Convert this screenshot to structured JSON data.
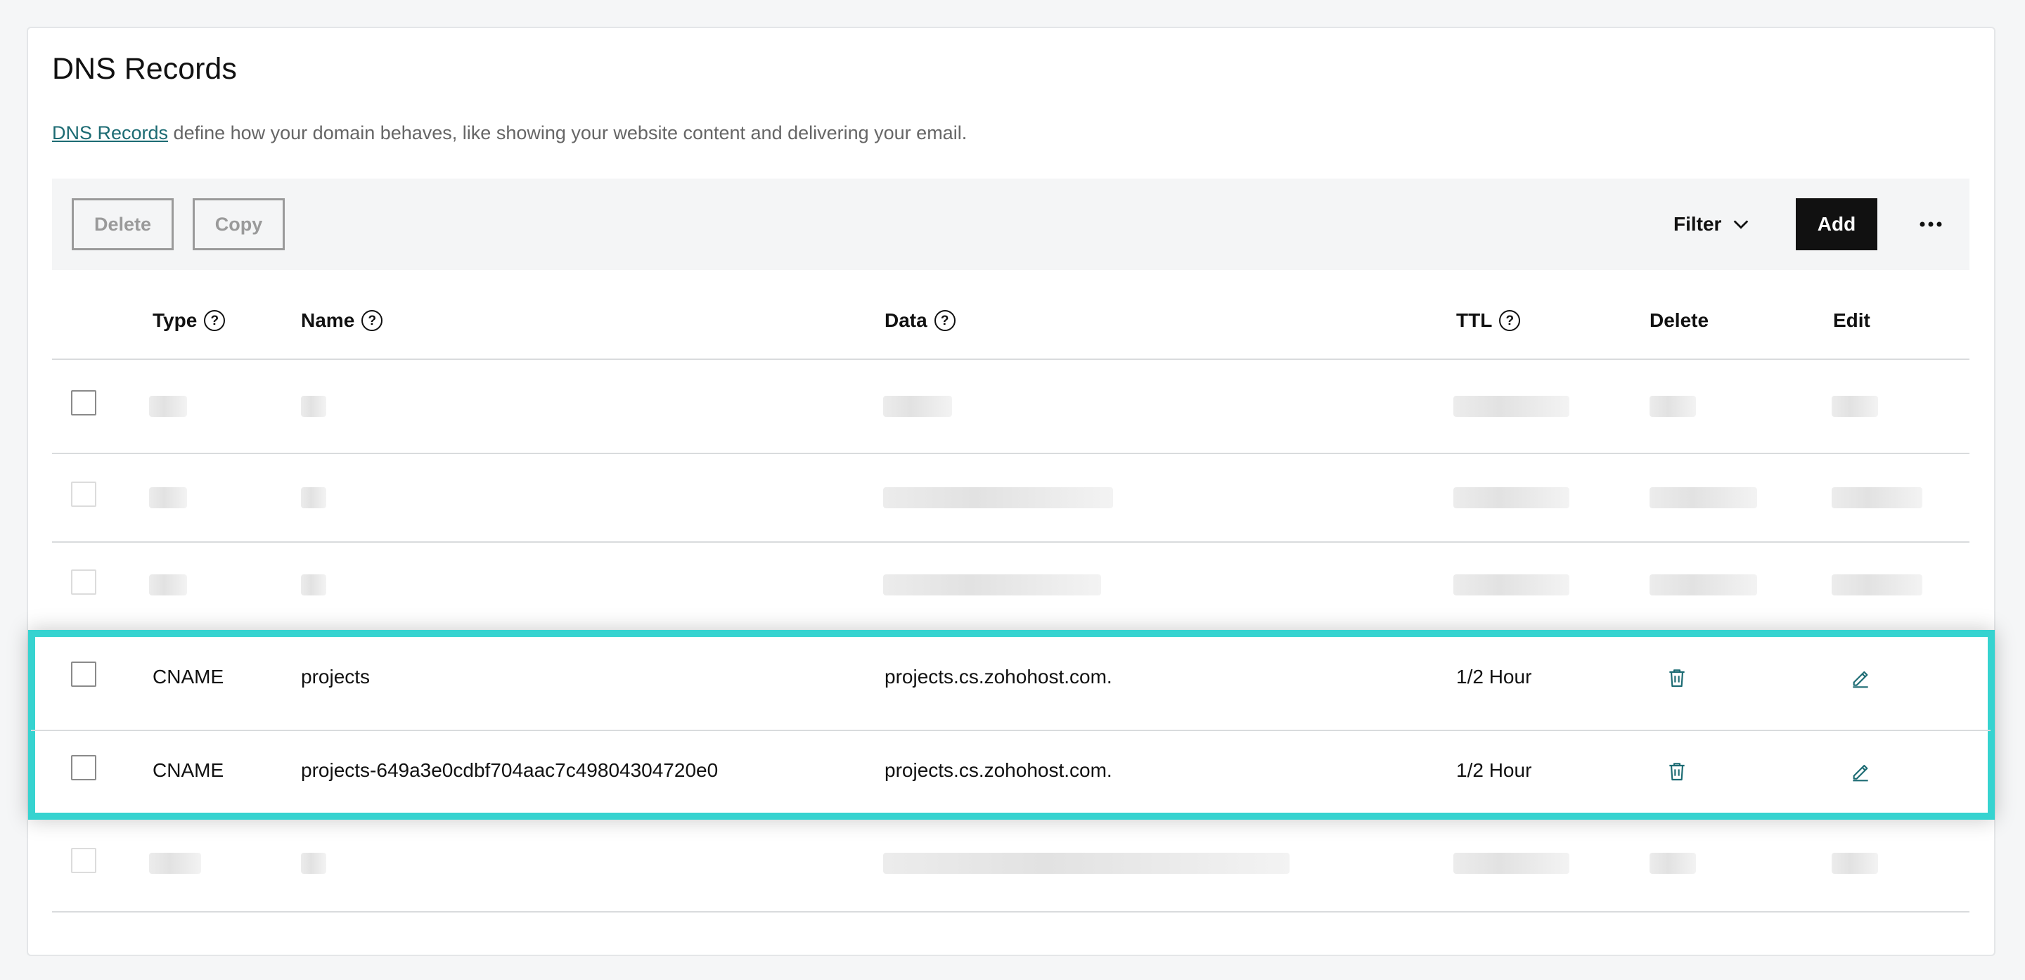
{
  "page": {
    "title": "DNS Records",
    "description_link": "DNS Records",
    "description_rest": " define how your domain behaves, like showing your website content and delivering your email."
  },
  "toolbar": {
    "delete_label": "Delete",
    "copy_label": "Copy",
    "filter_label": "Filter",
    "add_label": "Add"
  },
  "table": {
    "columns": [
      "Type",
      "Name",
      "Data",
      "TTL",
      "Delete",
      "Edit"
    ],
    "help_glyph": "?",
    "rows": [
      {
        "type": "CNAME",
        "name": "projects",
        "data": "projects.cs.zohohost.com.",
        "ttl": "1/2 Hour"
      },
      {
        "type": "CNAME",
        "name": "projects-649a3e0cdbf704aac7c49804304720e0",
        "data": "projects.cs.zohohost.com.",
        "ttl": "1/2 Hour"
      }
    ]
  },
  "colors": {
    "accent_teal": "#1c6b73",
    "highlight": "#36d3d0",
    "add_button": "#111111"
  },
  "icons": [
    "question-circle-icon",
    "chevron-down-icon",
    "ellipsis-icon",
    "trash-icon",
    "pencil-icon"
  ]
}
